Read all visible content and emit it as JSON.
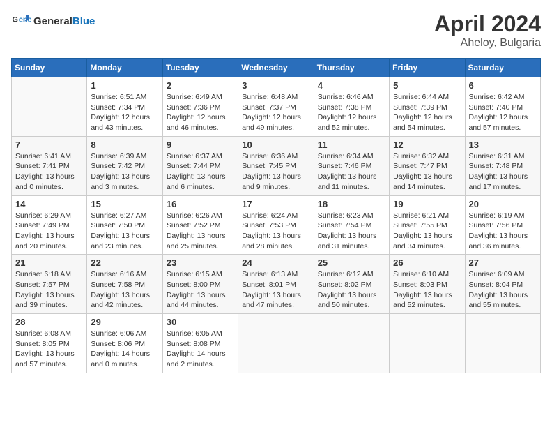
{
  "header": {
    "logo_line1": "General",
    "logo_line2": "Blue",
    "month": "April 2024",
    "location": "Aheloy, Bulgaria"
  },
  "weekdays": [
    "Sunday",
    "Monday",
    "Tuesday",
    "Wednesday",
    "Thursday",
    "Friday",
    "Saturday"
  ],
  "weeks": [
    [
      {
        "day": "",
        "info": ""
      },
      {
        "day": "1",
        "info": "Sunrise: 6:51 AM\nSunset: 7:34 PM\nDaylight: 12 hours\nand 43 minutes."
      },
      {
        "day": "2",
        "info": "Sunrise: 6:49 AM\nSunset: 7:36 PM\nDaylight: 12 hours\nand 46 minutes."
      },
      {
        "day": "3",
        "info": "Sunrise: 6:48 AM\nSunset: 7:37 PM\nDaylight: 12 hours\nand 49 minutes."
      },
      {
        "day": "4",
        "info": "Sunrise: 6:46 AM\nSunset: 7:38 PM\nDaylight: 12 hours\nand 52 minutes."
      },
      {
        "day": "5",
        "info": "Sunrise: 6:44 AM\nSunset: 7:39 PM\nDaylight: 12 hours\nand 54 minutes."
      },
      {
        "day": "6",
        "info": "Sunrise: 6:42 AM\nSunset: 7:40 PM\nDaylight: 12 hours\nand 57 minutes."
      }
    ],
    [
      {
        "day": "7",
        "info": "Sunrise: 6:41 AM\nSunset: 7:41 PM\nDaylight: 13 hours\nand 0 minutes."
      },
      {
        "day": "8",
        "info": "Sunrise: 6:39 AM\nSunset: 7:42 PM\nDaylight: 13 hours\nand 3 minutes."
      },
      {
        "day": "9",
        "info": "Sunrise: 6:37 AM\nSunset: 7:44 PM\nDaylight: 13 hours\nand 6 minutes."
      },
      {
        "day": "10",
        "info": "Sunrise: 6:36 AM\nSunset: 7:45 PM\nDaylight: 13 hours\nand 9 minutes."
      },
      {
        "day": "11",
        "info": "Sunrise: 6:34 AM\nSunset: 7:46 PM\nDaylight: 13 hours\nand 11 minutes."
      },
      {
        "day": "12",
        "info": "Sunrise: 6:32 AM\nSunset: 7:47 PM\nDaylight: 13 hours\nand 14 minutes."
      },
      {
        "day": "13",
        "info": "Sunrise: 6:31 AM\nSunset: 7:48 PM\nDaylight: 13 hours\nand 17 minutes."
      }
    ],
    [
      {
        "day": "14",
        "info": "Sunrise: 6:29 AM\nSunset: 7:49 PM\nDaylight: 13 hours\nand 20 minutes."
      },
      {
        "day": "15",
        "info": "Sunrise: 6:27 AM\nSunset: 7:50 PM\nDaylight: 13 hours\nand 23 minutes."
      },
      {
        "day": "16",
        "info": "Sunrise: 6:26 AM\nSunset: 7:52 PM\nDaylight: 13 hours\nand 25 minutes."
      },
      {
        "day": "17",
        "info": "Sunrise: 6:24 AM\nSunset: 7:53 PM\nDaylight: 13 hours\nand 28 minutes."
      },
      {
        "day": "18",
        "info": "Sunrise: 6:23 AM\nSunset: 7:54 PM\nDaylight: 13 hours\nand 31 minutes."
      },
      {
        "day": "19",
        "info": "Sunrise: 6:21 AM\nSunset: 7:55 PM\nDaylight: 13 hours\nand 34 minutes."
      },
      {
        "day": "20",
        "info": "Sunrise: 6:19 AM\nSunset: 7:56 PM\nDaylight: 13 hours\nand 36 minutes."
      }
    ],
    [
      {
        "day": "21",
        "info": "Sunrise: 6:18 AM\nSunset: 7:57 PM\nDaylight: 13 hours\nand 39 minutes."
      },
      {
        "day": "22",
        "info": "Sunrise: 6:16 AM\nSunset: 7:58 PM\nDaylight: 13 hours\nand 42 minutes."
      },
      {
        "day": "23",
        "info": "Sunrise: 6:15 AM\nSunset: 8:00 PM\nDaylight: 13 hours\nand 44 minutes."
      },
      {
        "day": "24",
        "info": "Sunrise: 6:13 AM\nSunset: 8:01 PM\nDaylight: 13 hours\nand 47 minutes."
      },
      {
        "day": "25",
        "info": "Sunrise: 6:12 AM\nSunset: 8:02 PM\nDaylight: 13 hours\nand 50 minutes."
      },
      {
        "day": "26",
        "info": "Sunrise: 6:10 AM\nSunset: 8:03 PM\nDaylight: 13 hours\nand 52 minutes."
      },
      {
        "day": "27",
        "info": "Sunrise: 6:09 AM\nSunset: 8:04 PM\nDaylight: 13 hours\nand 55 minutes."
      }
    ],
    [
      {
        "day": "28",
        "info": "Sunrise: 6:08 AM\nSunset: 8:05 PM\nDaylight: 13 hours\nand 57 minutes."
      },
      {
        "day": "29",
        "info": "Sunrise: 6:06 AM\nSunset: 8:06 PM\nDaylight: 14 hours\nand 0 minutes."
      },
      {
        "day": "30",
        "info": "Sunrise: 6:05 AM\nSunset: 8:08 PM\nDaylight: 14 hours\nand 2 minutes."
      },
      {
        "day": "",
        "info": ""
      },
      {
        "day": "",
        "info": ""
      },
      {
        "day": "",
        "info": ""
      },
      {
        "day": "",
        "info": ""
      }
    ]
  ]
}
